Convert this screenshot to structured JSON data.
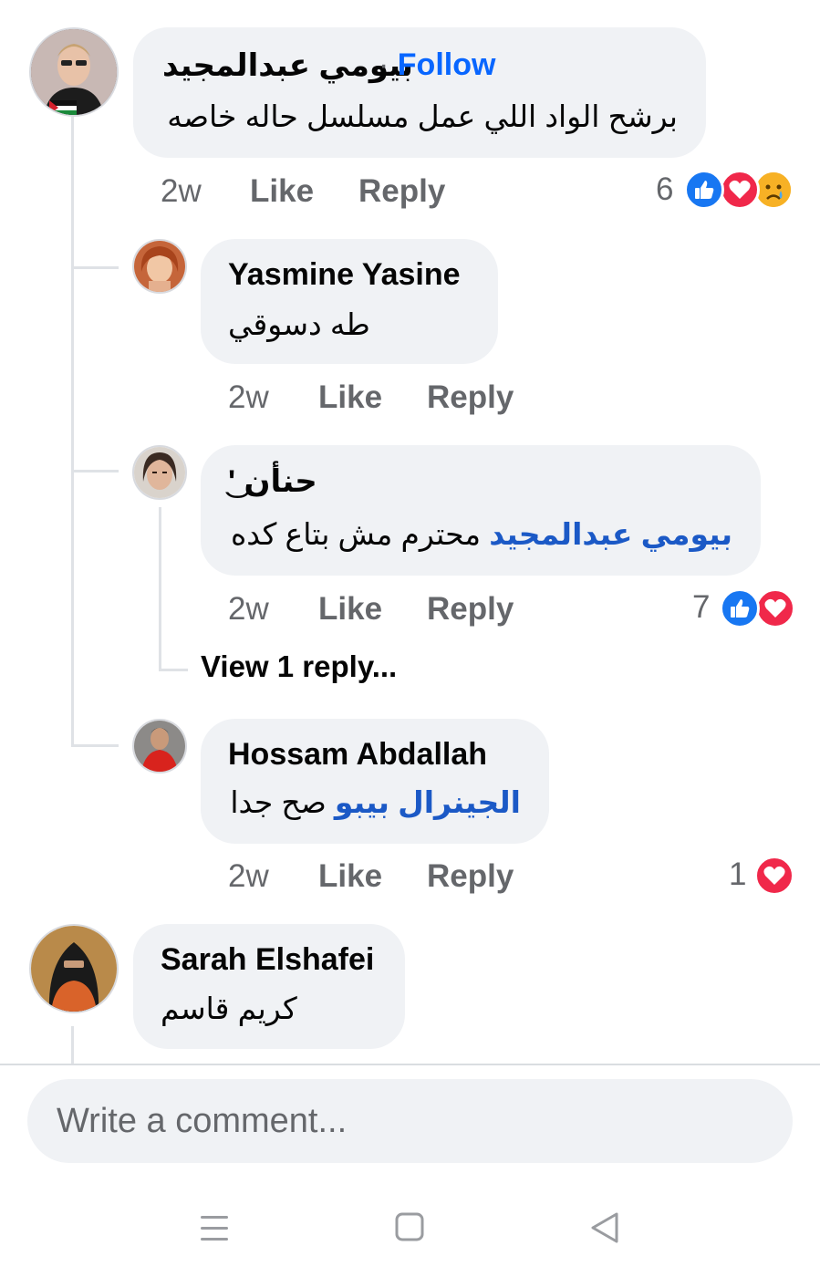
{
  "comments": [
    {
      "author": "بيومي عبدالمجيد",
      "follow_sep": "·",
      "follow_label": "Follow",
      "text": "برشح الواد اللي عمل مسلسل حاله خاصه",
      "time": "2w",
      "like_label": "Like",
      "reply_label": "Reply",
      "reaction_count": "6",
      "reactions": [
        "like-icon",
        "love-icon",
        "sad-icon"
      ]
    },
    {
      "author": "Yasmine Yasine",
      "text": "طه دسوقي",
      "time": "2w",
      "like_label": "Like",
      "reply_label": "Reply"
    },
    {
      "author": "حنأن '͜",
      "mention": "بيومي عبدالمجيد",
      "text": "محترم مش بتاع كده",
      "time": "2w",
      "like_label": "Like",
      "reply_label": "Reply",
      "reaction_count": "7",
      "reactions": [
        "like-icon",
        "love-icon"
      ],
      "view_replies": "View 1 reply..."
    },
    {
      "author": "Hossam Abdallah",
      "mention": "الجينرال بيبو",
      "text": "صح جدا",
      "time": "2w",
      "like_label": "Like",
      "reply_label": "Reply",
      "reaction_count": "1",
      "reactions": [
        "love-icon"
      ]
    },
    {
      "author": "Sarah Elshafei",
      "text": "كريم قاسم"
    }
  ],
  "composer": {
    "placeholder": "Write a comment..."
  },
  "navbar": {
    "icons": [
      "menu-icon",
      "home-square-icon",
      "back-triangle-icon"
    ]
  },
  "colors": {
    "bubble": "#f0f2f5",
    "follow": "#0866ff",
    "mention": "#1b59c6",
    "like": "#1877f2",
    "love": "#f0284a",
    "sad": "#f7b125"
  }
}
